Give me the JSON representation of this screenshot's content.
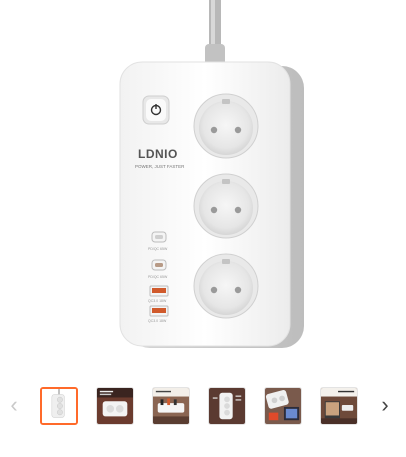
{
  "product": {
    "brand": "LDNIO",
    "tagline": "POWER, JUST FASTER",
    "port_labels": [
      "PD/QC 65W",
      "PD/QC 65W",
      "QC3.0 18W",
      "QC3.0 18W"
    ]
  },
  "gallery": {
    "prev_icon": "chevron-left-icon",
    "next_icon": "chevron-right-icon",
    "prev_symbol": "‹",
    "next_symbol": "›",
    "active_index": 0,
    "accent_color": "#ff6a2a",
    "thumbnail_count": 6
  }
}
